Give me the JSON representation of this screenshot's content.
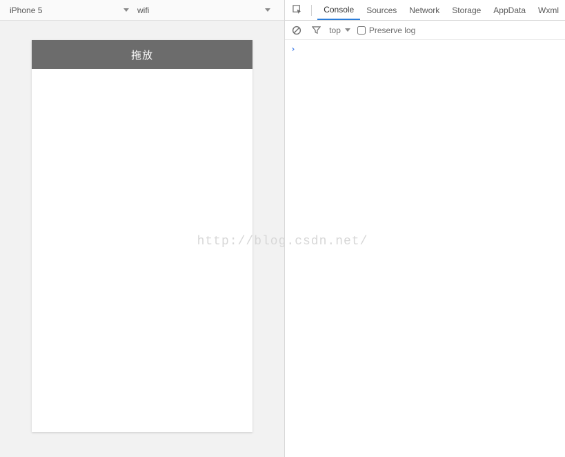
{
  "simulator": {
    "device": "iPhone 5",
    "network": "wifi",
    "app_title": "拖放"
  },
  "devtools": {
    "tabs": {
      "console": "Console",
      "sources": "Sources",
      "network": "Network",
      "storage": "Storage",
      "appdata": "AppData",
      "wxml": "Wxml"
    },
    "active_tab": "console",
    "toolbar": {
      "context": "top",
      "preserve_label": "Preserve log",
      "preserve_checked": false
    },
    "console_prompt": "›"
  },
  "watermark": "http://blog.csdn.net/"
}
